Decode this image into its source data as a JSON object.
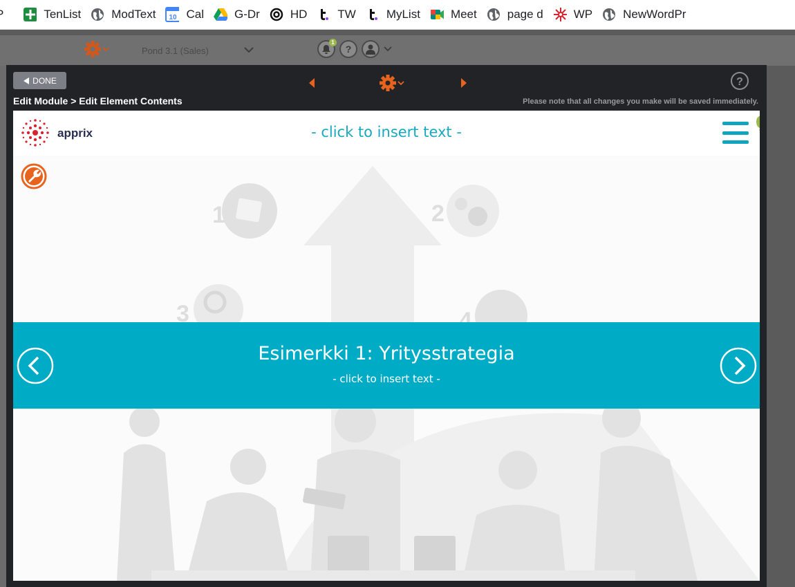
{
  "bookmarks": [
    {
      "label": "P",
      "icon": "partial-icon"
    },
    {
      "label": "TenList",
      "icon": "green-plus-icon"
    },
    {
      "label": "ModText",
      "icon": "globe-icon"
    },
    {
      "label": "Cal",
      "icon": "calendar-icon",
      "icon_text": "10"
    },
    {
      "label": "G-Dr",
      "icon": "google-drive-icon"
    },
    {
      "label": "HD",
      "icon": "at-spiral-icon"
    },
    {
      "label": "TW",
      "icon": "t-icon"
    },
    {
      "label": "MyList",
      "icon": "t-icon"
    },
    {
      "label": "Meet",
      "icon": "meet-icon"
    },
    {
      "label": "page d",
      "icon": "globe-icon"
    },
    {
      "label": "WP",
      "icon": "snowflake-icon"
    },
    {
      "label": "NewWordPr",
      "icon": "globe-icon"
    }
  ],
  "appbar": {
    "pond_label": "Pond 3.1 (Sales)",
    "notification_count": "1",
    "help_glyph": "?"
  },
  "editor": {
    "done_label": "DONE",
    "breadcrumb": "Edit Module > Edit Element Contents",
    "note": "Please note that all changes you make will be saved immediately.",
    "help_glyph": "?"
  },
  "canvas": {
    "logo_text": "apprix",
    "header_placeholder": "- click to insert text -",
    "banner_title": "Esimerkki 1: Yritysstrategia",
    "banner_subtitle": "- click to insert text -"
  },
  "colors": {
    "accent_orange": "#e8641e",
    "teal": "#00acc5",
    "logo_red": "#d8242f",
    "dark_modal": "#222327"
  }
}
